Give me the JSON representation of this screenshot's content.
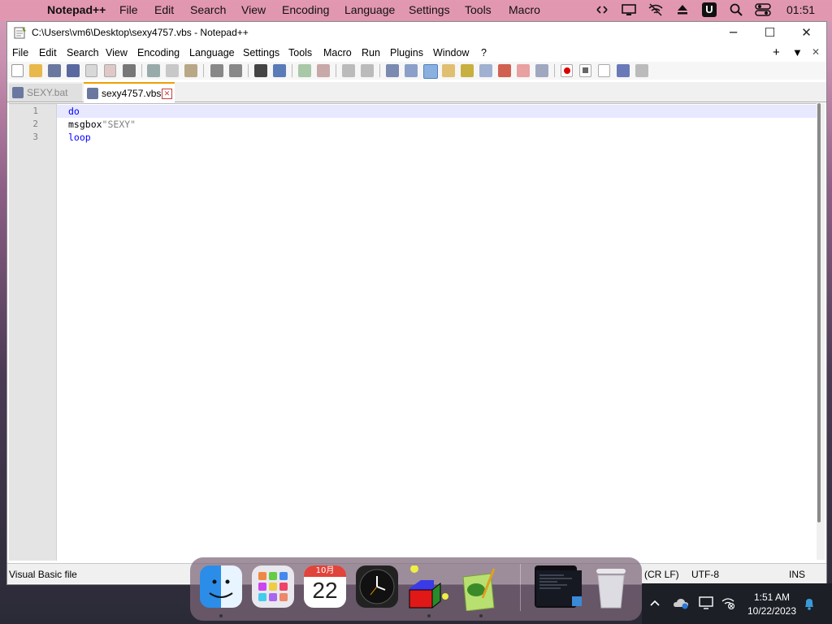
{
  "mac_menubar": {
    "apple": "",
    "app_name": "Notepad++",
    "items": [
      "File",
      "Edit",
      "Search",
      "View",
      "Encoding",
      "Language",
      "Settings",
      "Tools",
      "Macro"
    ],
    "clock": "01:51"
  },
  "window": {
    "title": "C:\\Users\\vm6\\Desktop\\sexy4757.vbs - Notepad++",
    "minimize": "─",
    "maximize": "☐",
    "close": "✕"
  },
  "menubar": {
    "items": [
      "File",
      "Edit",
      "Search",
      "View",
      "Encoding",
      "Language",
      "Settings",
      "Tools",
      "Macro",
      "Run",
      "Plugins",
      "Window",
      "?"
    ],
    "right_plus": "+",
    "right_down": "▼",
    "right_close": "✕"
  },
  "tabs": [
    {
      "label": "SEXY.bat",
      "active": false
    },
    {
      "label": "sexy4757.vbs",
      "active": true,
      "close": "✕"
    }
  ],
  "editor": {
    "line_numbers": [
      "1",
      "2",
      "3"
    ],
    "lines": [
      {
        "keyword": "do",
        "rest": ""
      },
      {
        "keyword": "msgbox",
        "rest": "\"SEXY\""
      },
      {
        "keyword": "loop",
        "rest": ""
      }
    ]
  },
  "statusbar": {
    "filetype": "Visual Basic file",
    "eol": "(CR LF)",
    "encoding": "UTF-8",
    "mode": "INS"
  },
  "dock": {
    "calendar_month": "10月",
    "calendar_day": "22",
    "apps": [
      "finder-icon",
      "launchpad-icon",
      "calendar-icon",
      "clock-icon",
      "app-icon",
      "notepadpp-icon",
      "window-thumbnail",
      "trash-icon"
    ]
  },
  "tray": {
    "time": "1:51 AM",
    "date": "10/22/2023"
  },
  "colors": {
    "keyword": "#0000ff",
    "string": "#808080",
    "current_line": "#e8e8ff"
  }
}
